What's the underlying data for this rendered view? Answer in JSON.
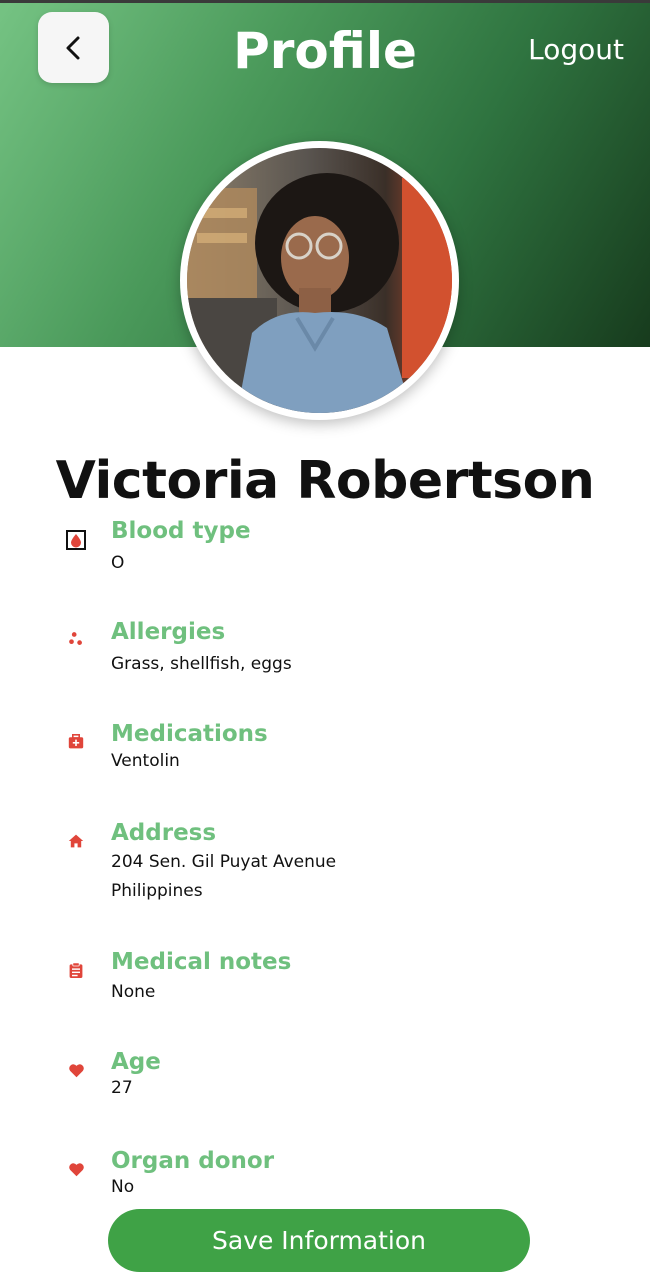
{
  "header": {
    "title": "Profile",
    "logout_label": "Logout",
    "back_icon": "chevron-left-icon"
  },
  "profile": {
    "name": "Victoria Robertson",
    "avatar": "profile-photo"
  },
  "fields": [
    {
      "label": "Blood type",
      "value": "O",
      "icon": "blood-drop-icon"
    },
    {
      "label": "Allergies",
      "value": "Grass, shellfish, eggs",
      "icon": "allergens-icon"
    },
    {
      "label": "Medications",
      "value": "Ventolin",
      "icon": "medical-kit-icon"
    },
    {
      "label": "Address",
      "value_line1": "204 Sen. Gil Puyat Avenue",
      "value_line2": "Philippines",
      "icon": "home-icon"
    },
    {
      "label": "Medical notes",
      "value": "None",
      "icon": "clipboard-icon"
    },
    {
      "label": "Age",
      "value": "27",
      "icon": "heart-icon"
    },
    {
      "label": "Organ donor",
      "value": "No",
      "icon": "heart-icon"
    }
  ],
  "actions": {
    "save_label": "Save Information"
  },
  "colors": {
    "label_green": "#6fc07e",
    "button_green": "#3fa246",
    "icon_red": "#e0453a"
  }
}
